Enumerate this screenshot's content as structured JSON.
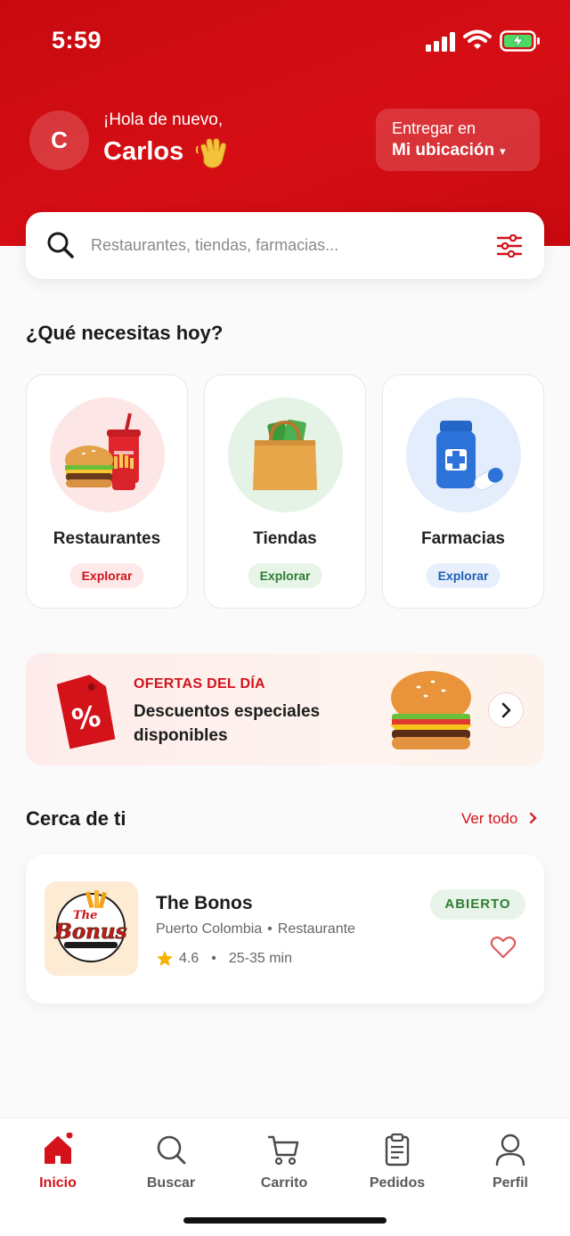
{
  "status_bar": {
    "time": "5:59"
  },
  "header": {
    "avatar_initial": "C",
    "greeting": "¡Hola de nuevo,",
    "user_name": "Carlos",
    "deliver_label": "Entregar en",
    "deliver_location": "Mi ubicación",
    "deliver_caret": "▾"
  },
  "search": {
    "placeholder": "Restaurantes, tiendas, farmacias..."
  },
  "categories_section": {
    "title": "¿Qué necesitas hoy?",
    "items": [
      {
        "label": "Restaurantes",
        "action": "Explorar",
        "color": "#d3121a",
        "bg": "#fde9e9"
      },
      {
        "label": "Tiendas",
        "action": "Explorar",
        "color": "#2e7d32",
        "bg": "#e7f4e8"
      },
      {
        "label": "Farmacias",
        "action": "Explorar",
        "color": "#1e5fb4",
        "bg": "#e6effb"
      }
    ]
  },
  "promo": {
    "kicker": "OFERTAS DEL DÍA",
    "description": "Descuentos especiales disponibles"
  },
  "nearby": {
    "title": "Cerca de ti",
    "see_all": "Ver todo",
    "restaurants": [
      {
        "logo_text_1": "The",
        "logo_text_2": "Bonus",
        "name": "The Bonos",
        "city": "Puerto Colombia",
        "type": "Restaurante",
        "rating": "4.6",
        "time": "25-35 min",
        "status": "ABIERTO"
      }
    ]
  },
  "nav": {
    "items": [
      {
        "label": "Inicio",
        "icon": "home-icon",
        "active": true
      },
      {
        "label": "Buscar",
        "icon": "search-icon"
      },
      {
        "label": "Carrito",
        "icon": "cart-icon"
      },
      {
        "label": "Pedidos",
        "icon": "clipboard-icon"
      },
      {
        "label": "Perfil",
        "icon": "user-icon"
      }
    ]
  },
  "colors": {
    "brand": "#d3121a",
    "open": "#2e7d32"
  }
}
